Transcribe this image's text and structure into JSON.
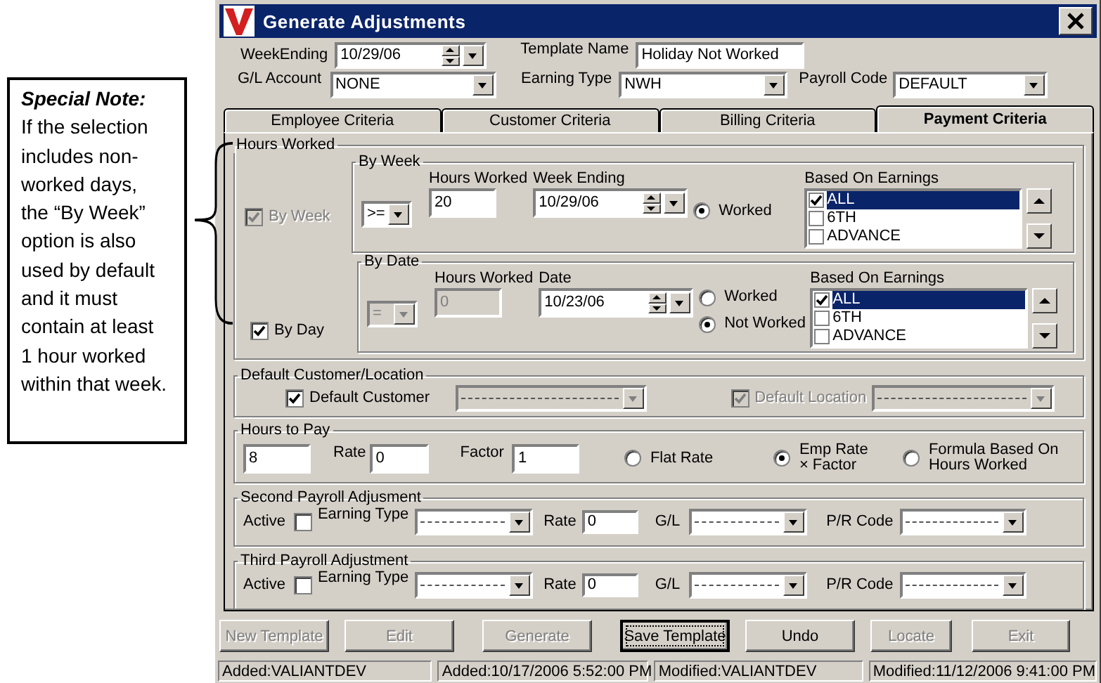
{
  "note": {
    "title": "Special Note:",
    "text": "If the selection includes non-worked days, the “By Week” option is also used by default and it must contain at least 1 hour worked within that week."
  },
  "window": {
    "title": "Generate Adjustments"
  },
  "form": {
    "week_ending": {
      "label": "WeekEnding",
      "value": "10/29/06"
    },
    "template_name": {
      "label": "Template Name",
      "value": "Holiday Not Worked"
    },
    "gl_account": {
      "label": "G/L Account",
      "value": "NONE"
    },
    "earning_type": {
      "label": "Earning Type",
      "value": "NWH"
    },
    "payroll_code": {
      "label": "Payroll Code",
      "value": "DEFAULT"
    }
  },
  "tabs": [
    {
      "label": "Employee Criteria",
      "selected": false
    },
    {
      "label": "Customer Criteria",
      "selected": false
    },
    {
      "label": "Billing Criteria",
      "selected": false
    },
    {
      "label": "Payment Criteria",
      "selected": true
    }
  ],
  "hours_worked": {
    "title": "Hours Worked",
    "sections": [
      {
        "title": "By Week",
        "option": {
          "label": "By Week",
          "checked": true,
          "disabled": true
        },
        "operator": {
          "value": ">=",
          "disabled": false
        },
        "hours": {
          "label": "Hours Worked",
          "value": "20",
          "disabled": false
        },
        "date": {
          "label": "Week Ending",
          "value": "10/29/06"
        },
        "radios": [
          {
            "label": "Worked",
            "selected": true
          }
        ],
        "earnings": {
          "label": "Based On Earnings",
          "items": [
            {
              "label": "ALL",
              "checked": true,
              "selected": true
            },
            {
              "label": "6TH",
              "checked": false,
              "selected": false
            },
            {
              "label": "ADVANCE",
              "checked": false,
              "selected": false
            }
          ]
        }
      },
      {
        "title": "By Date",
        "option": {
          "label": "By Day",
          "checked": true,
          "disabled": false
        },
        "operator": {
          "value": "=",
          "disabled": true
        },
        "hours": {
          "label": "Hours Worked",
          "value": "0",
          "disabled": true
        },
        "date": {
          "label": "Date",
          "value": "10/23/06"
        },
        "radios": [
          {
            "label": "Worked",
            "selected": false
          },
          {
            "label": "Not Worked",
            "selected": true
          }
        ],
        "earnings": {
          "label": "Based On Earnings",
          "items": [
            {
              "label": "ALL",
              "checked": true,
              "selected": true
            },
            {
              "label": "6TH",
              "checked": false,
              "selected": false
            },
            {
              "label": "ADVANCE",
              "checked": false,
              "selected": false
            }
          ]
        }
      }
    ]
  },
  "default_location": {
    "title": "Default Customer/Location",
    "options": [
      {
        "label": "Default Customer",
        "checked": true,
        "disabled": false
      },
      {
        "label": "Default Location",
        "checked": true,
        "disabled": true
      }
    ]
  },
  "hours_to_pay": {
    "title": "Hours to Pay",
    "hours": "8",
    "rate": {
      "label": "Rate",
      "value": "0"
    },
    "factor": {
      "label": "Factor",
      "value": "1"
    },
    "radios": [
      {
        "label": "Flat Rate",
        "selected": false
      },
      {
        "label": "Emp Rate\n× Factor",
        "selected": true
      },
      {
        "label": "Formula Based On\nHours Worked",
        "selected": false
      }
    ]
  },
  "adjustments": [
    {
      "title": "Second Payroll Adjusment",
      "active": {
        "label": "Active",
        "checked": false
      },
      "earning_type": "Earning Type",
      "rate": {
        "label": "Rate",
        "value": "0"
      },
      "gl": "G/L",
      "pr_code": "P/R Code"
    },
    {
      "title": "Third Payroll Adjustment",
      "active": {
        "label": "Active",
        "checked": false
      },
      "earning_type": "Earning Type",
      "rate": {
        "label": "Rate",
        "value": "0"
      },
      "gl": "G/L",
      "pr_code": "P/R Code"
    }
  ],
  "buttons": [
    {
      "label": "New Template",
      "disabled": true,
      "focused": false
    },
    {
      "label": "Edit",
      "disabled": true,
      "focused": false
    },
    {
      "label": "Generate",
      "disabled": true,
      "focused": false
    },
    {
      "label": "Save Template",
      "disabled": false,
      "focused": true
    },
    {
      "label": "Undo",
      "disabled": false,
      "focused": false
    },
    {
      "label": "Locate",
      "disabled": true,
      "focused": false
    },
    {
      "label": "Exit",
      "disabled": true,
      "focused": false
    }
  ],
  "status_bar": [
    "Added:VALIANTDEV",
    "Added:10/17/2006 5:52:00 PM",
    "Modified:VALIANTDEV",
    "Modified:11/12/2006 9:41:00 PM"
  ]
}
